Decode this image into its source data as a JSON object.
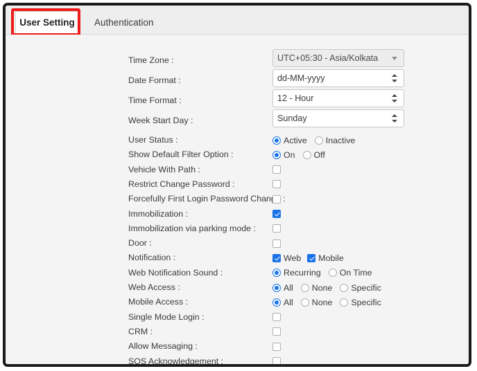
{
  "tabs": [
    {
      "label": "User Setting",
      "active": true
    },
    {
      "label": "Authentication",
      "active": false
    }
  ],
  "highlight_color": "#ee1b1b",
  "accent_color": "#1a73e8",
  "form": {
    "selects": [
      {
        "label": "Time Zone :",
        "value": "UTC+05:30 - Asia/Kolkata",
        "arrow": "caret-down-icon",
        "disabled": true
      },
      {
        "label": "Date Format :",
        "value": "dd-MM-yyyy",
        "arrow": "spinner-icon",
        "disabled": false
      },
      {
        "label": "Time Format :",
        "value": "12 - Hour",
        "arrow": "spinner-icon",
        "disabled": false
      },
      {
        "label": "Week Start Day :",
        "value": "Sunday",
        "arrow": "spinner-icon",
        "disabled": false
      }
    ],
    "rows": [
      {
        "label": "User Status :",
        "type": "radio",
        "options": [
          {
            "label": "Active",
            "checked": true
          },
          {
            "label": "Inactive",
            "checked": false
          }
        ]
      },
      {
        "label": "Show Default Filter Option :",
        "type": "radio",
        "options": [
          {
            "label": "On",
            "checked": true
          },
          {
            "label": "Off",
            "checked": false
          }
        ]
      },
      {
        "label": "Vehicle With Path :",
        "type": "checkbox",
        "checked": false
      },
      {
        "label": "Restrict Change Password :",
        "type": "checkbox",
        "checked": false
      },
      {
        "label": "Forcefully First Login Password Change :",
        "type": "checkbox",
        "checked": false,
        "wide": true
      },
      {
        "label": "Immobilization :",
        "type": "checkbox",
        "checked": true
      },
      {
        "label": "Immobilization via parking mode :",
        "type": "checkbox",
        "checked": false
      },
      {
        "label": "Door :",
        "type": "checkbox",
        "checked": false
      },
      {
        "label": "Notification :",
        "type": "checkbox-group",
        "options": [
          {
            "label": "Web",
            "checked": true
          },
          {
            "label": "Mobile",
            "checked": true
          }
        ]
      },
      {
        "label": "Web Notification Sound :",
        "type": "radio",
        "options": [
          {
            "label": "Recurring",
            "checked": true
          },
          {
            "label": "On Time",
            "checked": false
          }
        ]
      },
      {
        "label": "Web Access :",
        "type": "radio",
        "options": [
          {
            "label": "All",
            "checked": true
          },
          {
            "label": "None",
            "checked": false
          },
          {
            "label": "Specific",
            "checked": false
          }
        ]
      },
      {
        "label": "Mobile Access :",
        "type": "radio",
        "options": [
          {
            "label": "All",
            "checked": true
          },
          {
            "label": "None",
            "checked": false
          },
          {
            "label": "Specific",
            "checked": false
          }
        ]
      },
      {
        "label": "Single Mode Login :",
        "type": "checkbox",
        "checked": false
      },
      {
        "label": "CRM :",
        "type": "checkbox",
        "checked": false
      },
      {
        "label": "Allow Messaging :",
        "type": "checkbox",
        "checked": false
      },
      {
        "label": "SOS Acknowledgement :",
        "type": "checkbox",
        "checked": false
      }
    ]
  }
}
